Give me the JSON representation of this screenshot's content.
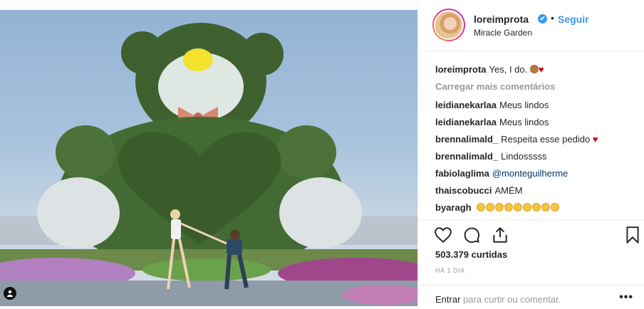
{
  "post": {
    "username": "loreimprota",
    "verified_badge": "✔",
    "separator": "•",
    "follow_label": "Seguir",
    "location": "Miracle Garden"
  },
  "caption": {
    "username": "loreimprota",
    "text": "Yes, I do."
  },
  "load_more_label": "Carregar mais comentários",
  "comments": [
    {
      "user": "leidianekarlaa",
      "text": "Meus lindos"
    },
    {
      "user": "leidianekarlaa",
      "text": "Meus lindos"
    },
    {
      "user": "brennalimald_",
      "text": "Respeita esse pedido"
    },
    {
      "user": "brennalimald_",
      "text": "Lindosssss"
    },
    {
      "user": "fabiolaglima",
      "text": "@monteguilherme"
    },
    {
      "user": "thaiscobucci",
      "text": "AMÉM"
    },
    {
      "user": "byaragh",
      "text": ""
    }
  ],
  "likes_text": "503.379 curtidas",
  "time_text": "HÁ 1 DIA",
  "footer": {
    "login_label": "Entrar",
    "login_suffix": " para curtir ou comentar.",
    "more_label": "•••"
  },
  "icons": {
    "like": "heart-icon",
    "comment": "comment-icon",
    "share": "share-icon",
    "save": "bookmark-icon",
    "tag": "user-tag-icon"
  },
  "colors": {
    "accent": "#3897f0",
    "heart": "#d0021b",
    "muted": "#999999"
  }
}
